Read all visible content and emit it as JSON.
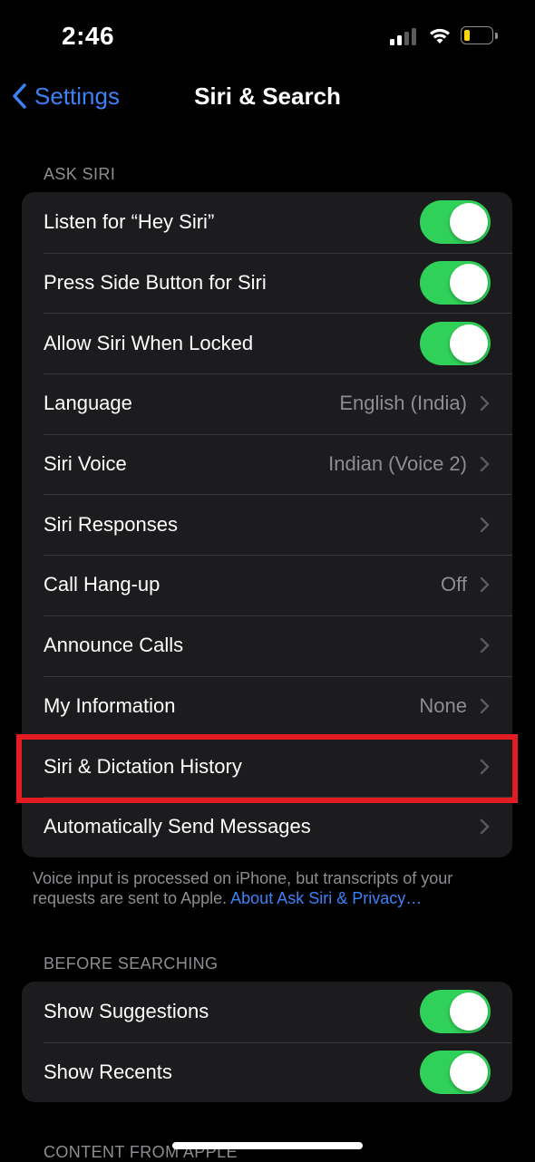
{
  "status_bar": {
    "time": "2:46",
    "battery_level": 0.2,
    "battery_color": "#ffd60a"
  },
  "nav": {
    "back_label": "Settings",
    "title": "Siri & Search"
  },
  "ask_siri": {
    "header": "ASK SIRI",
    "rows": [
      {
        "label": "Listen for “Hey Siri”",
        "toggle": true
      },
      {
        "label": "Press Side Button for Siri",
        "toggle": true
      },
      {
        "label": "Allow Siri When Locked",
        "toggle": true
      },
      {
        "label": "Language",
        "value": "English (India)"
      },
      {
        "label": "Siri Voice",
        "value": "Indian (Voice 2)"
      },
      {
        "label": "Siri Responses",
        "value": ""
      },
      {
        "label": "Call Hang-up",
        "value": "Off"
      },
      {
        "label": "Announce Calls",
        "value": ""
      },
      {
        "label": "My Information",
        "value": "None"
      },
      {
        "label": "Siri & Dictation History",
        "value": ""
      },
      {
        "label": "Automatically Send Messages",
        "value": ""
      }
    ],
    "footnote_text": "Voice input is processed on iPhone, but transcripts of your requests are sent to Apple.",
    "footnote_link": "About Ask Siri & Privacy…"
  },
  "before_searching": {
    "header": "BEFORE SEARCHING",
    "rows": [
      {
        "label": "Show Suggestions",
        "toggle": true
      },
      {
        "label": "Show Recents",
        "toggle": true
      }
    ]
  },
  "content_from_apple": {
    "header": "CONTENT FROM APPLE"
  },
  "colors": {
    "accent": "#3b82f6",
    "toggle_on": "#30d158",
    "highlight": "#e31b23"
  }
}
